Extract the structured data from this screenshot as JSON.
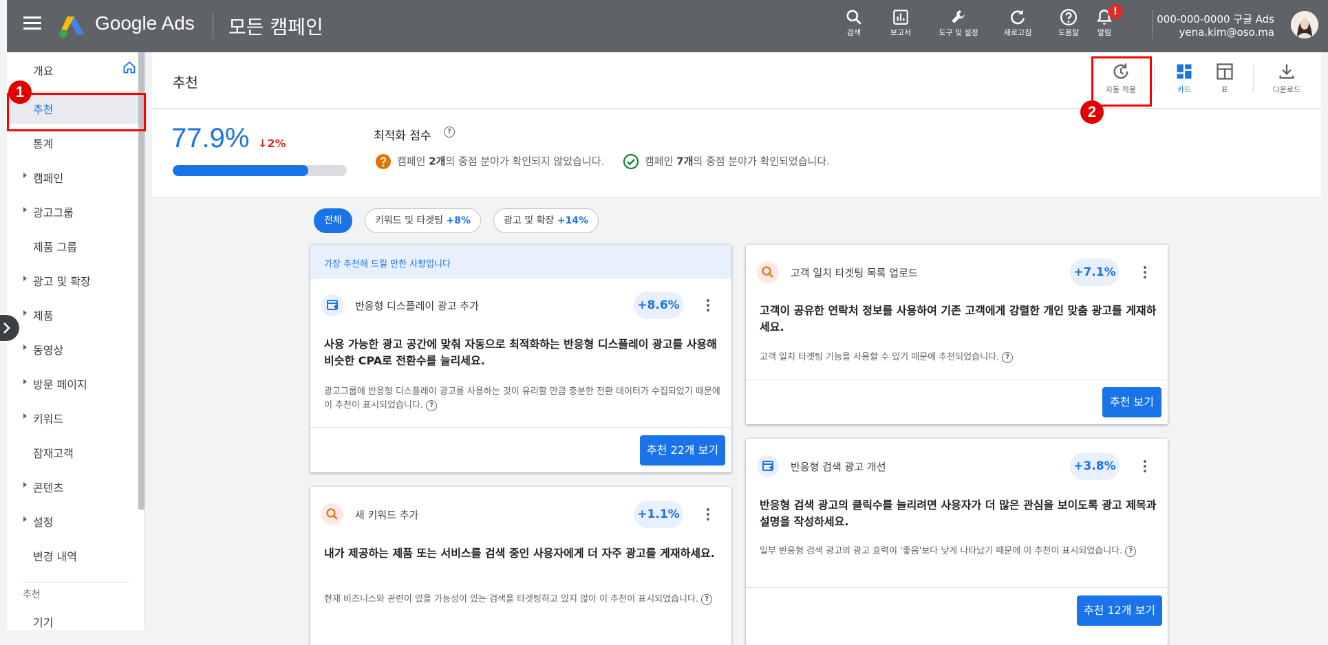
{
  "topbar": {
    "brand": "Google Ads",
    "page": "모든 캠페인",
    "items": [
      {
        "label": "검색",
        "icon": "search-icon"
      },
      {
        "label": "보고서",
        "icon": "reports-icon"
      },
      {
        "label": "도구 및 설정",
        "icon": "wrench-icon"
      },
      {
        "label": "새로고침",
        "icon": "refresh-icon"
      },
      {
        "label": "도움말",
        "icon": "help-icon"
      },
      {
        "label": "알림",
        "icon": "bell-icon"
      }
    ],
    "alert_badge": "!",
    "account_id": "000-000-0000 구글 Ads",
    "account_email": "yena.kim@oso.ma"
  },
  "sidenav": {
    "items": [
      {
        "label": "개요",
        "expandable": false
      },
      {
        "label": "추천",
        "expandable": false,
        "active": true
      },
      {
        "label": "통계",
        "expandable": false
      },
      {
        "label": "캠페인",
        "expandable": true
      },
      {
        "label": "광고그룹",
        "expandable": true
      },
      {
        "label": "제품 그룹",
        "expandable": false
      },
      {
        "label": "광고 및 확장",
        "expandable": true
      },
      {
        "label": "제품",
        "expandable": true
      },
      {
        "label": "동영상",
        "expandable": true
      },
      {
        "label": "방문 페이지",
        "expandable": true
      },
      {
        "label": "키워드",
        "expandable": true
      },
      {
        "label": "잠재고객",
        "expandable": false
      },
      {
        "label": "콘텐츠",
        "expandable": true
      },
      {
        "label": "설정",
        "expandable": true
      },
      {
        "label": "변경 내역",
        "expandable": false
      }
    ],
    "section_title": "추천",
    "section_items": [
      "기기"
    ]
  },
  "header": {
    "title": "추천",
    "buttons": [
      {
        "label": "자동 적용",
        "icon": "auto-apply-icon"
      },
      {
        "label": "카드",
        "icon": "card-view-icon"
      },
      {
        "label": "표",
        "icon": "table-view-icon"
      },
      {
        "label": "다운로드",
        "icon": "download-icon"
      }
    ]
  },
  "score": {
    "value": "77.9%",
    "change": "2%",
    "progress": 0.779,
    "title": "최적화 점수",
    "help": "?",
    "warn_text_pre": "캠페인 ",
    "warn_count": "2개",
    "warn_text_post": "의 중점 분야가 확인되지 않았습니다.",
    "ok_text_pre": "캠페인 ",
    "ok_count": "7개",
    "ok_text_post": "의 중점 분야가 확인되었습니다."
  },
  "chips": [
    {
      "label": "전체",
      "pct": ""
    },
    {
      "label": "키워드 및 타겟팅",
      "pct": "+8%"
    },
    {
      "label": "광고 및 확장",
      "pct": "+14%"
    }
  ],
  "cards": {
    "top_banner": "가장 추천해 드릴 만한 사항입니다",
    "display_ad": {
      "title": "반응형 디스플레이 광고 추가",
      "uplift": "+8.6%",
      "headline": "사용 가능한 광고 공간에 맞춰 자동으로 최적화하는 반응형 디스플레이 광고를 사용해 비슷한 CPA로 전환수를 늘리세요.",
      "reason": "광고그룹에 반응형 디스플레이 광고를 사용하는 것이 유리할 만큼 충분한 전환 데이터가 수집되었기 때문에 이 추천이 표시되었습니다.",
      "button": "추천 22개 보기"
    },
    "keywords": {
      "title": "새 키워드 추가",
      "uplift": "+1.1%",
      "headline": "내가 제공하는 제품 또는 서비스를 검색 중인 사용자에게 더 자주 광고를 게재하세요.",
      "reason": "현재 비즈니스와 관련이 있을 가능성이 있는 검색을 타겟팅하고 있지 않아 이 추천이 표시되었습니다."
    },
    "customer_match": {
      "title": "고객 일치 타겟팅 목록 업로드",
      "uplift": "+7.1%",
      "headline": "고객이 공유한 연락처 정보를 사용하여 기존 고객에게 강렬한 개인 맞춤 광고를 게재하세요.",
      "reason": "고객 일치 타겟팅 기능을 사용할 수 있기 때문에 추천되었습니다.",
      "button": "추천 보기"
    },
    "search_ad": {
      "title": "반응형 검색 광고 개선",
      "uplift": "+3.8%",
      "headline": "반응형 검색 광고의 클릭수를 늘리려면 사용자가 더 많은 관심을 보이도록 광고 제목과 설명을 작성하세요.",
      "reason": "일부 반응형 검색 광고의 광고 효력이 '좋음'보다 낮게 나타났기 때문에 이 추천이 표시되었습니다.",
      "button": "추천 12개 보기"
    }
  },
  "annotations": [
    "1",
    "2"
  ],
  "colors": {
    "accent": "#1a73e8",
    "topbar": "#5f6368",
    "annotation": "#ff0000",
    "decline": "#d93025"
  }
}
